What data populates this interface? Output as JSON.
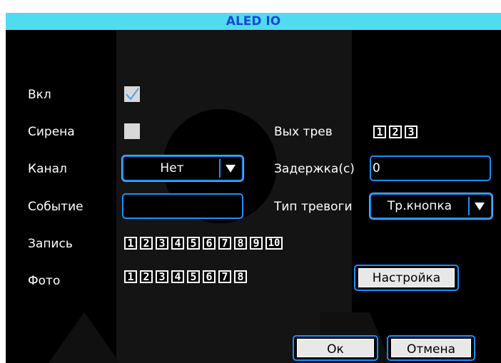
{
  "window": {
    "title": "ALED IO"
  },
  "labels": {
    "enable": "Вкл",
    "siren": "Сирена",
    "channel": "Канал",
    "event": "Событие",
    "record": "Запись",
    "photo": "Фото",
    "alarm_out": "Вых трев",
    "delay": "Задержка(с)",
    "alarm_type": "Тип тревоги"
  },
  "values": {
    "enable_checked": true,
    "siren_checked": false,
    "channel_selected": "Нет",
    "delay_value": "0",
    "event_value": "",
    "alarm_type_selected": "Тр.кнопка"
  },
  "alarm_out_channels": [
    "1",
    "2",
    "3"
  ],
  "record_channels": [
    "1",
    "2",
    "3",
    "4",
    "5",
    "6",
    "7",
    "8",
    "9",
    "10"
  ],
  "photo_channels": [
    "1",
    "2",
    "3",
    "4",
    "5",
    "6",
    "7",
    "8"
  ],
  "buttons": {
    "setup": "Настройка",
    "ok": "Ок",
    "cancel": "Отмена"
  },
  "colors": {
    "title_bg": "#4fdcf0",
    "title_text": "#1c44d8",
    "accent_border": "#1c8eff",
    "background": "#000000"
  },
  "icons": {
    "dropdown": "triangle-down-icon",
    "check": "checkmark-icon"
  }
}
